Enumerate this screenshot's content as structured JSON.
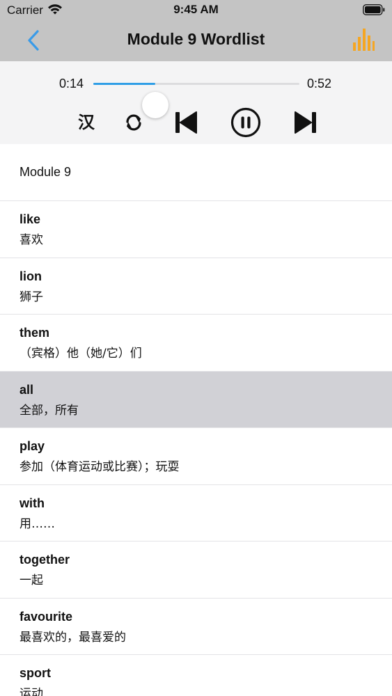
{
  "status_bar": {
    "carrier": "Carrier",
    "time": "9:45 AM"
  },
  "nav": {
    "title": "Module 9  Wordlist",
    "back_icon": "chevron-left-icon",
    "right_icon": "bar-chart-icon",
    "accent_color": "#f5a623",
    "back_color": "#3a9be8"
  },
  "player": {
    "current_time": "0:14",
    "total_time": "0:52",
    "progress": 0.3,
    "lang_toggle_label": "汉",
    "icons": [
      "repeat-icon",
      "skip-previous-icon",
      "pause-icon",
      "skip-next-icon"
    ],
    "accent_color": "#2f9ee6"
  },
  "list": {
    "section": "Module 9",
    "selected_index": 3,
    "items": [
      {
        "en": "like",
        "zh": "喜欢"
      },
      {
        "en": "lion",
        "zh": "狮子"
      },
      {
        "en": "them",
        "zh": "（宾格）他（她/它）们"
      },
      {
        "en": "all",
        "zh": "全部，所有"
      },
      {
        "en": "play",
        "zh": "参加（体育运动或比赛）；玩耍"
      },
      {
        "en": "with",
        "zh": "用……"
      },
      {
        "en": "together",
        "zh": "一起"
      },
      {
        "en": "favourite",
        "zh": "最喜欢的，最喜爱的"
      },
      {
        "en": "sport",
        "zh": "运动"
      }
    ]
  }
}
